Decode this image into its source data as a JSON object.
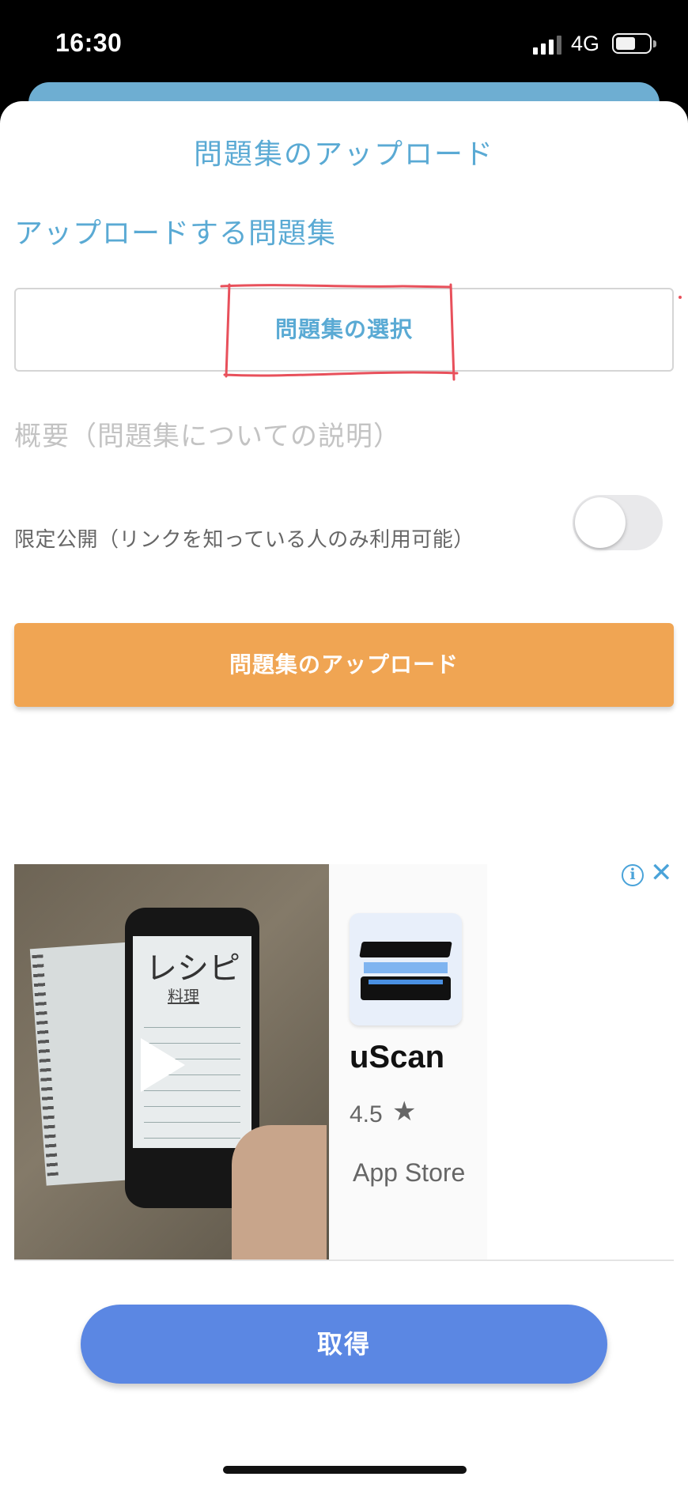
{
  "status_bar": {
    "time": "16:30",
    "network": "4G"
  },
  "sheet": {
    "title": "問題集のアップロード",
    "section_label": "アップロードする問題集",
    "select_button_label": "問題集の選択",
    "summary_placeholder": "概要（問題集についての説明）",
    "summary_value": "",
    "limited_label": "限定公開（リンクを知っている人のみ利用可能）",
    "limited_enabled": false,
    "upload_button_label": "問題集のアップロード"
  },
  "ad": {
    "video_screen_title": "レシピ",
    "video_screen_subtitle": "料理",
    "app_name": "uScan",
    "rating": "4.5",
    "store": "App Store",
    "info_icon": "info-icon",
    "close_icon": "close-icon",
    "get_button_label": "取得"
  },
  "colors": {
    "accent": "#5aaad4",
    "upload_button": "#f0a553",
    "get_button": "#5b87e3",
    "annotation": "#e8505b"
  }
}
